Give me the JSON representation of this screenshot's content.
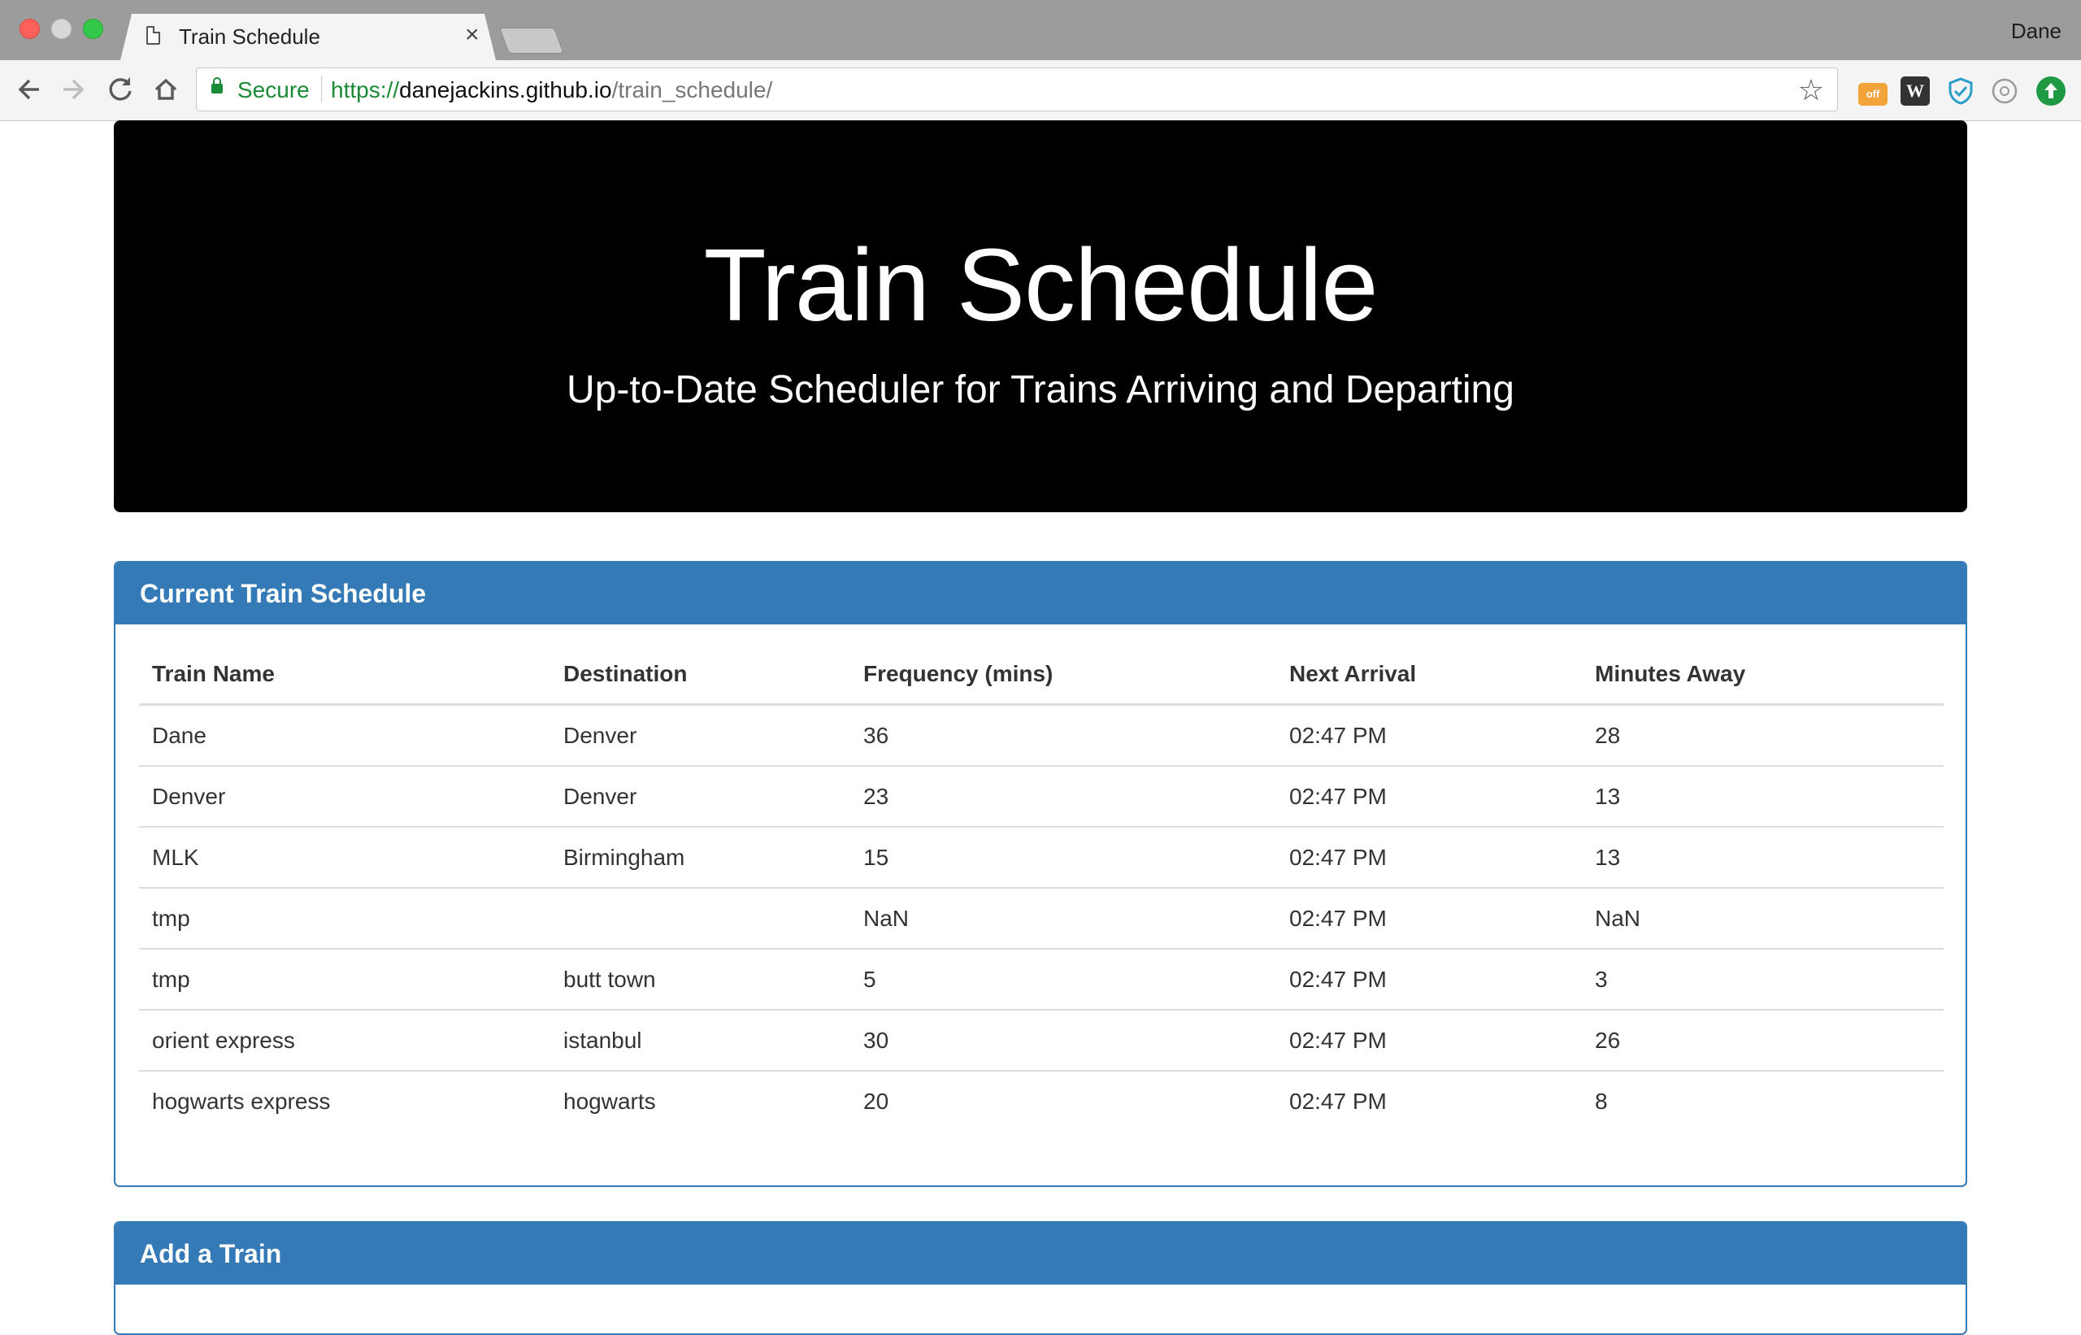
{
  "browser": {
    "tab_title": "Train Schedule",
    "tab_close": "×",
    "profile_name": "Dane",
    "secure_label": "Secure",
    "url_scheme": "https://",
    "url_host": "danejackins.github.io",
    "url_path": "/train_schedule/",
    "extensions": [
      "coupon-off-icon",
      "wikipedia-icon",
      "shield-icon",
      "circle-extension-icon",
      "upload-arrow-icon"
    ],
    "ext_off_label": "off",
    "ext_wiki_label": "W"
  },
  "header": {
    "title": "Train Schedule",
    "subtitle": "Up-to-Date Scheduler for Trains Arriving and Departing"
  },
  "schedule_panel": {
    "heading": "Current Train Schedule",
    "columns": [
      "Train Name",
      "Destination",
      "Frequency (mins)",
      "Next Arrival",
      "Minutes Away"
    ],
    "rows": [
      [
        "Dane",
        "Denver",
        "36",
        "02:47 PM",
        "28"
      ],
      [
        "Denver",
        "Denver",
        "23",
        "02:47 PM",
        "13"
      ],
      [
        "MLK",
        "Birmingham",
        "15",
        "02:47 PM",
        "13"
      ],
      [
        "tmp",
        "",
        "NaN",
        "02:47 PM",
        "NaN"
      ],
      [
        "tmp",
        "butt town",
        "5",
        "02:47 PM",
        "3"
      ],
      [
        "orient express",
        "istanbul",
        "30",
        "02:47 PM",
        "26"
      ],
      [
        "hogwarts express",
        "hogwarts",
        "20",
        "02:47 PM",
        "8"
      ]
    ]
  },
  "add_panel": {
    "heading": "Add a Train"
  },
  "colors": {
    "panel_primary": "#337ab7",
    "jumbotron_bg": "#000000",
    "secure_green": "#1b8a36"
  }
}
